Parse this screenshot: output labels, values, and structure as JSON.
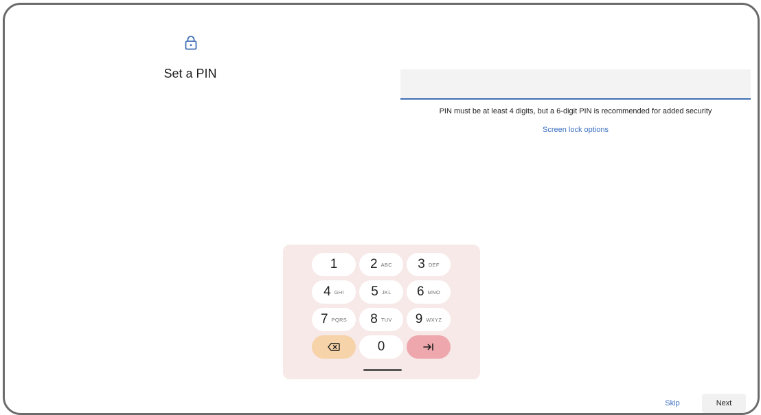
{
  "header": {
    "icon": "lock-icon",
    "title": "Set a PIN"
  },
  "pin_input": {
    "value": "",
    "hint": "PIN must be at least 4 digits, but a 6-digit PIN is recommended for added security",
    "accent_color": "#3f6fb5"
  },
  "screen_lock_options_label": "Screen lock options",
  "keypad": {
    "background": "#f7e9e8",
    "keys": [
      {
        "digit": "1",
        "letters": ""
      },
      {
        "digit": "2",
        "letters": "ABC"
      },
      {
        "digit": "3",
        "letters": "DEF"
      },
      {
        "digit": "4",
        "letters": "GHI"
      },
      {
        "digit": "5",
        "letters": "JKL"
      },
      {
        "digit": "6",
        "letters": "MNO"
      },
      {
        "digit": "7",
        "letters": "PQRS"
      },
      {
        "digit": "8",
        "letters": "TUV"
      },
      {
        "digit": "9",
        "letters": "WXYZ"
      },
      {
        "digit": "0",
        "letters": ""
      }
    ],
    "backspace_icon": "backspace-icon",
    "backspace_color": "#f6d3a9",
    "enter_icon": "tab-enter-icon",
    "enter_color": "#eda7ad"
  },
  "footer": {
    "skip_label": "Skip",
    "next_label": "Next"
  }
}
